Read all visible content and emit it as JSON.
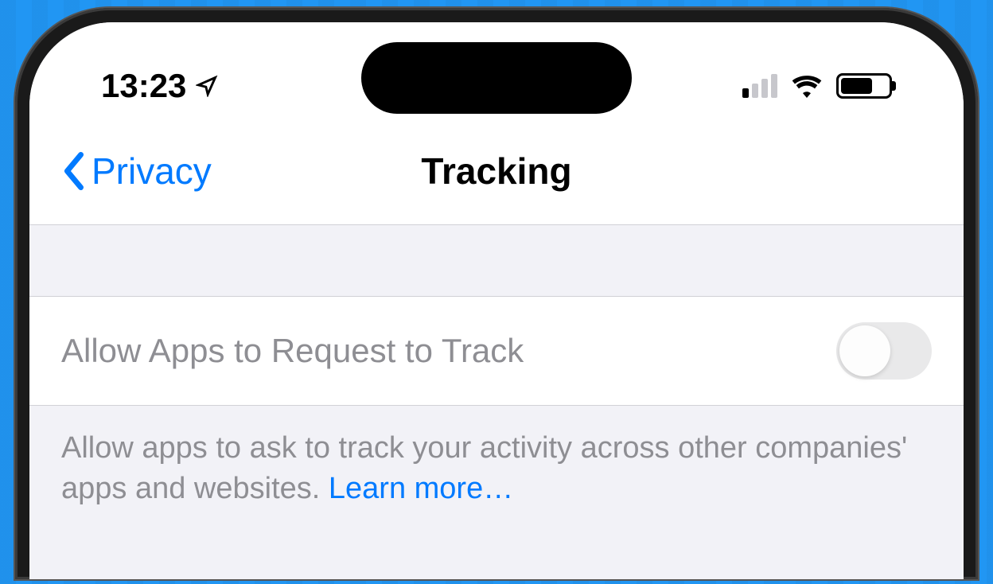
{
  "statusBar": {
    "time": "13:23",
    "locationIconName": "location-arrow-icon",
    "signalStrength": 1,
    "wifiIconName": "wifi-icon",
    "batteryPercent": 68
  },
  "navBar": {
    "backLabel": "Privacy",
    "title": "Tracking"
  },
  "setting": {
    "label": "Allow Apps to Request to Track",
    "toggleState": "off"
  },
  "description": {
    "text": "Allow apps to ask to track your activity across other companies' apps and websites. ",
    "learnMore": "Learn more…"
  }
}
